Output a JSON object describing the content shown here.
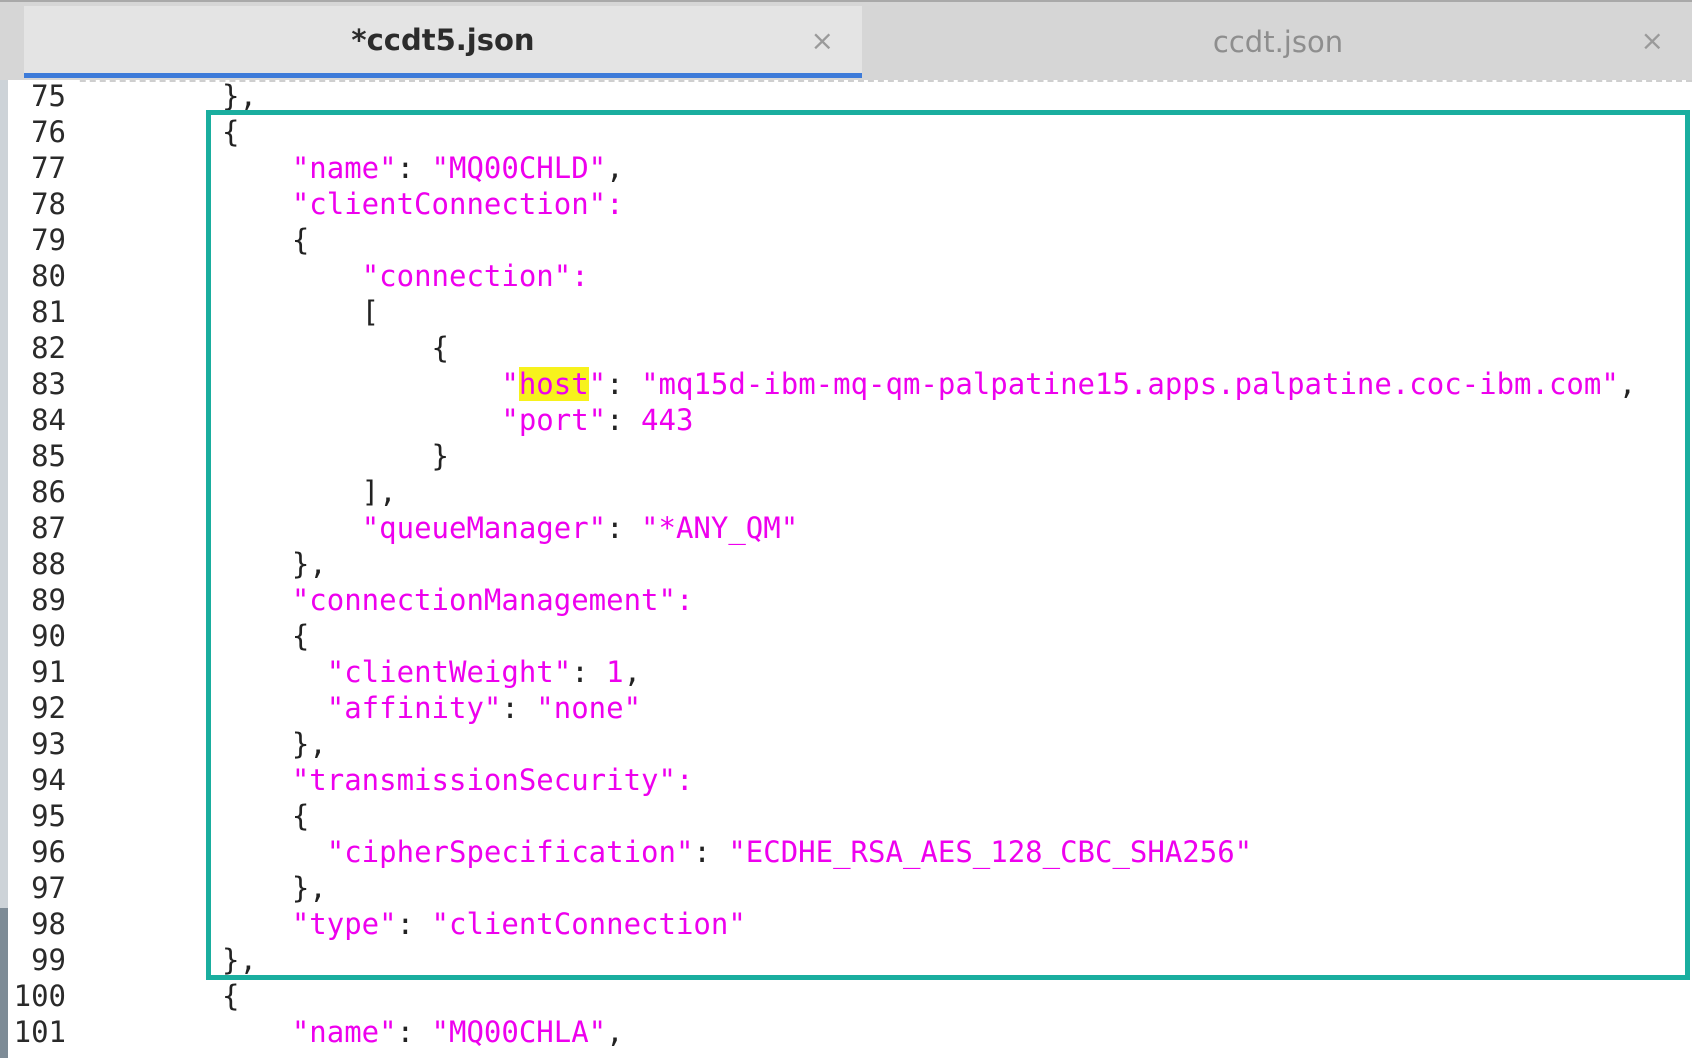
{
  "tabs": [
    {
      "label": "*ccdt5.json",
      "close": "×",
      "active": true
    },
    {
      "label": "ccdt.json",
      "close": "×",
      "active": false
    }
  ],
  "lines": [
    {
      "n": "75",
      "segs": [
        {
          "t": "},",
          "c": "p"
        }
      ]
    },
    {
      "n": "76",
      "segs": [
        {
          "t": "{",
          "c": "p"
        }
      ]
    },
    {
      "n": "77",
      "segs": [
        {
          "t": "    ",
          "c": "p"
        },
        {
          "t": "\"name\"",
          "c": "s"
        },
        {
          "t": ": ",
          "c": "p"
        },
        {
          "t": "\"MQ00CHLD\"",
          "c": "s"
        },
        {
          "t": ",",
          "c": "p"
        }
      ]
    },
    {
      "n": "78",
      "segs": [
        {
          "t": "    ",
          "c": "p"
        },
        {
          "t": "\"clientConnection\":",
          "c": "s"
        }
      ]
    },
    {
      "n": "79",
      "segs": [
        {
          "t": "    {",
          "c": "p"
        }
      ]
    },
    {
      "n": "80",
      "segs": [
        {
          "t": "        ",
          "c": "p"
        },
        {
          "t": "\"connection\":",
          "c": "s"
        }
      ]
    },
    {
      "n": "81",
      "segs": [
        {
          "t": "        [",
          "c": "p"
        }
      ]
    },
    {
      "n": "82",
      "segs": [
        {
          "t": "            {",
          "c": "p"
        }
      ]
    },
    {
      "n": "83",
      "segs": [
        {
          "t": "                ",
          "c": "p"
        },
        {
          "t": "\"",
          "c": "s"
        },
        {
          "t": "host",
          "c": "s hl"
        },
        {
          "t": "\"",
          "c": "s"
        },
        {
          "t": ": ",
          "c": "p"
        },
        {
          "t": "\"mq15d-ibm-mq-qm-palpatine15.apps.palpatine.coc-ibm.com\"",
          "c": "s"
        },
        {
          "t": ",",
          "c": "p"
        }
      ]
    },
    {
      "n": "84",
      "segs": [
        {
          "t": "                ",
          "c": "p"
        },
        {
          "t": "\"port\"",
          "c": "s"
        },
        {
          "t": ": ",
          "c": "p"
        },
        {
          "t": "443",
          "c": "s"
        }
      ]
    },
    {
      "n": "85",
      "segs": [
        {
          "t": "            }",
          "c": "p"
        }
      ]
    },
    {
      "n": "86",
      "segs": [
        {
          "t": "        ],",
          "c": "p"
        }
      ]
    },
    {
      "n": "87",
      "segs": [
        {
          "t": "        ",
          "c": "p"
        },
        {
          "t": "\"queueManager\"",
          "c": "s"
        },
        {
          "t": ": ",
          "c": "p"
        },
        {
          "t": "\"*ANY_QM\"",
          "c": "s"
        }
      ]
    },
    {
      "n": "88",
      "segs": [
        {
          "t": "    },",
          "c": "p"
        }
      ]
    },
    {
      "n": "89",
      "segs": [
        {
          "t": "    ",
          "c": "p"
        },
        {
          "t": "\"connectionManagement\":",
          "c": "s"
        }
      ]
    },
    {
      "n": "90",
      "segs": [
        {
          "t": "    {",
          "c": "p"
        }
      ]
    },
    {
      "n": "91",
      "segs": [
        {
          "t": "      ",
          "c": "p"
        },
        {
          "t": "\"clientWeight\"",
          "c": "s"
        },
        {
          "t": ": ",
          "c": "p"
        },
        {
          "t": "1",
          "c": "s"
        },
        {
          "t": ",",
          "c": "p"
        }
      ]
    },
    {
      "n": "92",
      "segs": [
        {
          "t": "      ",
          "c": "p"
        },
        {
          "t": "\"affinity\"",
          "c": "s"
        },
        {
          "t": ": ",
          "c": "p"
        },
        {
          "t": "\"none\"",
          "c": "s"
        }
      ]
    },
    {
      "n": "93",
      "segs": [
        {
          "t": "    },",
          "c": "p"
        }
      ]
    },
    {
      "n": "94",
      "segs": [
        {
          "t": "    ",
          "c": "p"
        },
        {
          "t": "\"transmissionSecurity\":",
          "c": "s"
        }
      ]
    },
    {
      "n": "95",
      "segs": [
        {
          "t": "    {",
          "c": "p"
        }
      ]
    },
    {
      "n": "96",
      "segs": [
        {
          "t": "      ",
          "c": "p"
        },
        {
          "t": "\"cipherSpecification\"",
          "c": "s"
        },
        {
          "t": ": ",
          "c": "p"
        },
        {
          "t": "\"ECDHE_RSA_AES_128_CBC_SHA256\"",
          "c": "s"
        }
      ]
    },
    {
      "n": "97",
      "segs": [
        {
          "t": "    },",
          "c": "p"
        }
      ]
    },
    {
      "n": "98",
      "segs": [
        {
          "t": "    ",
          "c": "p"
        },
        {
          "t": "\"type\"",
          "c": "s"
        },
        {
          "t": ": ",
          "c": "p"
        },
        {
          "t": "\"clientConnection\"",
          "c": "s"
        }
      ]
    },
    {
      "n": "99",
      "segs": [
        {
          "t": "},",
          "c": "p"
        }
      ]
    },
    {
      "n": "100",
      "segs": [
        {
          "t": "{",
          "c": "p"
        }
      ]
    },
    {
      "n": "101",
      "segs": [
        {
          "t": "    ",
          "c": "p"
        },
        {
          "t": "\"name\"",
          "c": "s"
        },
        {
          "t": ": ",
          "c": "p"
        },
        {
          "t": "\"MQ00CHLA\"",
          "c": "s"
        },
        {
          "t": ",",
          "c": "p"
        }
      ]
    }
  ],
  "colors": {
    "string": "#ee00ee",
    "highlight": "#f7f21c",
    "selection_box": "#1aae9f",
    "active_tab_underline": "#3d7bd9"
  }
}
